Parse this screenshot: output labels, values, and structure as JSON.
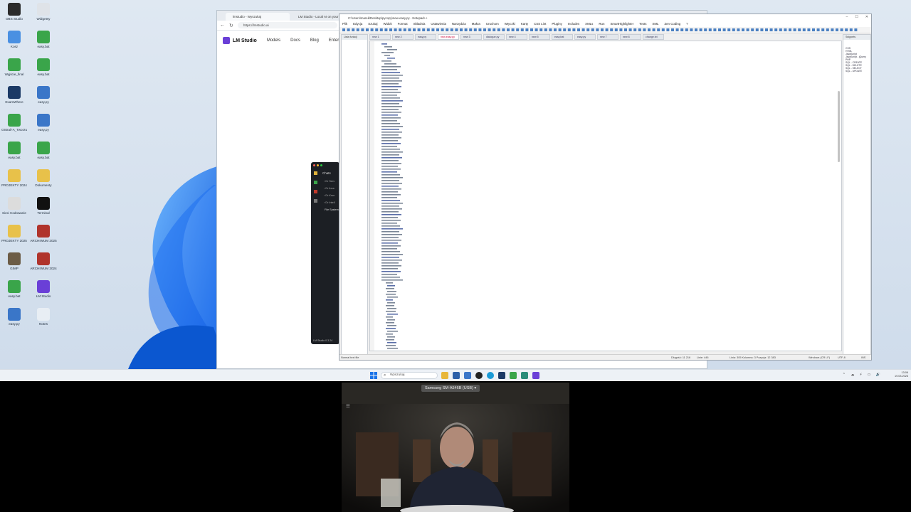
{
  "desktop": {
    "icons": [
      {
        "label": "OBS Studio",
        "color": "#2b2b2b"
      },
      {
        "label": "Widgetsy",
        "color": "#dfe3e8"
      },
      {
        "label": "Kosz",
        "color": "#4a90e2"
      },
      {
        "label": "easy.bat",
        "color": "#3aa54a"
      },
      {
        "label": "Wyjście_final",
        "color": "#3aa54a"
      },
      {
        "label": "easy.bat",
        "color": "#3aa54a"
      },
      {
        "label": "ExamWhere",
        "color": "#1c3a66"
      },
      {
        "label": "easy.py",
        "color": "#3a76c8"
      },
      {
        "label": "OStrail-A_Tworzu",
        "color": "#3aa54a"
      },
      {
        "label": "easy.py",
        "color": "#3a76c8"
      },
      {
        "label": "easy.bat",
        "color": "#3aa54a"
      },
      {
        "label": "easy.bat",
        "color": "#3aa54a"
      },
      {
        "label": "PROJEKTY 2024",
        "color": "#e8c14a"
      },
      {
        "label": "Dokumenty",
        "color": "#e8c14a"
      },
      {
        "label": "Sieci Kodowanie",
        "color": "#dcdcdc"
      },
      {
        "label": "Terminal",
        "color": "#111111"
      },
      {
        "label": "PROJEKTY 2025",
        "color": "#e8c14a"
      },
      {
        "label": "ARCHIWUM 2025",
        "color": "#b0342c"
      },
      {
        "label": "GIMP",
        "color": "#6c5c46"
      },
      {
        "label": "ARCHIWUM 2024",
        "color": "#b0342c"
      },
      {
        "label": "easy.bat",
        "color": "#3aa54a"
      },
      {
        "label": "LM Studio",
        "color": "#6a3fd7"
      },
      {
        "label": "easy.py",
        "color": "#3a76c8"
      },
      {
        "label": "Notes",
        "color": "#e8eef4"
      }
    ]
  },
  "browser": {
    "tabs": [
      "lmstudio - Wyszukaj",
      "LM Studio - Local AI on your"
    ],
    "url": "https://lmstudio.ai",
    "brand": "LM Studio",
    "nav": [
      "Models",
      "Docs",
      "Blog",
      "Enterprise"
    ]
  },
  "chats": {
    "title": "Chats",
    "rows": [
      "Dr Serv",
      "Dr Arcs",
      "Dr Kron",
      "Dr Intell",
      "File System"
    ],
    "footer": "LM Studio 0.3.24"
  },
  "npp": {
    "title": "C:\\Users\\marek\\Desktop\\pycopy\\new-easy.py - Notepad++",
    "menu": [
      "Plik",
      "Edycja",
      "Szukaj",
      "Widok",
      "Format",
      "Składnia",
      "Ustawienia",
      "Narzędzia",
      "Makra",
      "Uruchom",
      "Wtyczki",
      "Karty",
      "CSS Lint",
      "Pluginy",
      "Includes",
      "XMLs",
      "Run",
      "SmartHighlighter",
      "Tests",
      "XML",
      "Zen Coding",
      "?"
    ],
    "tabs": [
      "new 1",
      "new 2",
      "easy.py",
      "new-easy.py",
      "new 3",
      "dialogue.py",
      "new 4",
      "new 5",
      "easy.bat",
      "easy.py",
      "new 7",
      "new 8",
      "change.txt"
    ],
    "func_pane_title": "Lista funkcji",
    "right_pane_title": "Snippets",
    "right_pane_lines": [
      "CSS",
      "HTML",
      "JavaScript",
      "JavaScript - jQuery",
      "PHP",
      "SQL - CREATE",
      "SQL - DELETE",
      "SQL - SELECT",
      "SQL - UPDATE"
    ],
    "status": {
      "type": "Normal text file",
      "length": "Długość: 11 216",
      "lines": "Linie: 446",
      "position": "Linia: 305   Kolumna: 3   Pozycja: 12 383",
      "eol": "Windows (CR LF)",
      "encoding": "UTF-8",
      "mode": "INS"
    }
  },
  "taskbar": {
    "search": "Wyszukaj",
    "time": "13:06",
    "date": "19.03.2026"
  },
  "webcam": {
    "device": "Samsung SM-A546B (USB)"
  }
}
